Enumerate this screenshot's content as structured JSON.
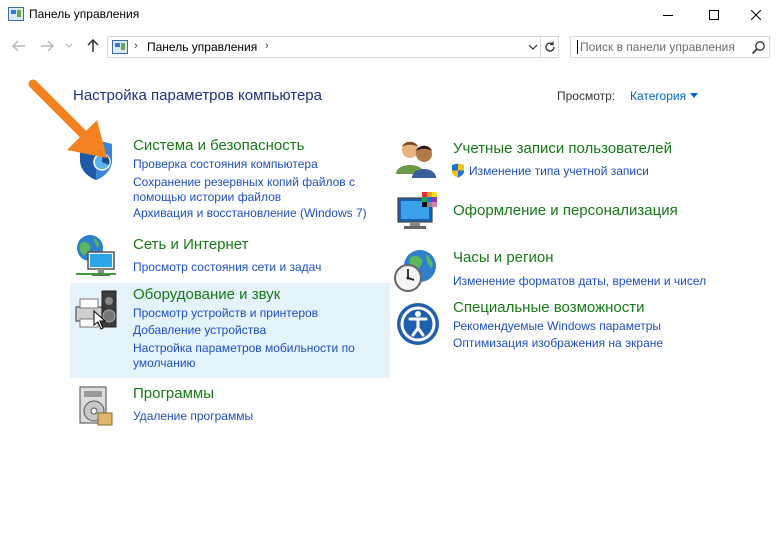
{
  "window": {
    "title": "Панель управления"
  },
  "address": {
    "breadcrumb": "Панель управления",
    "search_placeholder": "Поиск в панели управления"
  },
  "header": {
    "title": "Настройка параметров компьютера",
    "view_by_label": "Просмотр:",
    "view_by_value": "Категория"
  },
  "categories": {
    "system": {
      "title": "Система и безопасность",
      "links": [
        "Проверка состояния компьютера",
        "Сохранение резервных копий файлов с",
        "помощью истории файлов",
        "Архивация и восстановление (Windows 7)"
      ]
    },
    "network": {
      "title": "Сеть и Интернет",
      "links": [
        "Просмотр состояния сети и задач"
      ]
    },
    "hardware": {
      "title": "Оборудование и звук",
      "links": [
        "Просмотр устройств и принтеров",
        "Добавление устройства",
        "Настройка параметров мобильности по",
        "умолчанию"
      ]
    },
    "programs": {
      "title": "Программы",
      "links": [
        "Удаление программы"
      ]
    },
    "accounts": {
      "title": "Учетные записи пользователей",
      "links": [
        "Изменение типа учетной записи"
      ]
    },
    "appearance": {
      "title": "Оформление и персонализация",
      "links": []
    },
    "clock": {
      "title": "Часы и регион",
      "links": [
        "Изменение форматов даты, времени и чисел"
      ]
    },
    "ease": {
      "title": "Специальные возможности",
      "links": [
        "Рекомендуемые Windows параметры",
        "Оптимизация изображения на экране"
      ]
    }
  },
  "colors": {
    "category_title": "#167a16",
    "link": "#1d50c8",
    "page_title": "#1e3287",
    "highlight": "#e5f3fb",
    "annotation_arrow": "#f58220"
  },
  "icons": {
    "system": "shield-icon",
    "network": "globe-network-icon",
    "hardware": "printer-speaker-icon",
    "programs": "programs-disc-icon",
    "accounts": "users-icon",
    "appearance": "monitor-palette-icon",
    "clock": "clock-globe-icon",
    "ease": "accessibility-icon",
    "annotation": "orange-arrow-icon"
  }
}
